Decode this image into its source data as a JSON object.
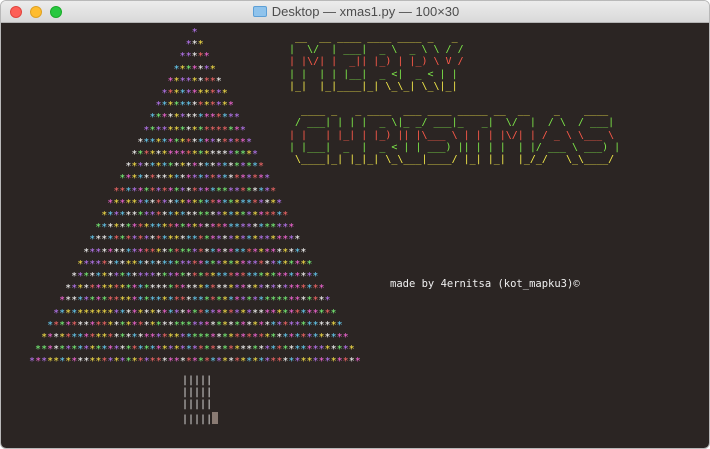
{
  "window": {
    "title": "Desktop — xmas1.py — 100×30",
    "icon": "folder-icon"
  },
  "terminal": {
    "background": "#2b2523",
    "credit": "made by 4ernitsa (kot_mapku3)©",
    "tree": {
      "glyph": "*",
      "colors": [
        "#ffffff",
        "#ffe84a",
        "#69d6ff",
        "#c07cff",
        "#ff6be0",
        "#7cff7c",
        "#ff6b6b"
      ],
      "trunk_line": "|||||",
      "trunk_rows": 4
    },
    "banner": {
      "merry": [
        "  __  __ ____ ____ ____ _   _  ",
        " |  \\/  | ___|  _ \\  _ \\ \\ / / ",
        " | |\\/| |  _|| |_) | |_) \\ V /  ",
        " | |  | | |__|  _ <|  _ < | |   ",
        " |_|  |_|____|_| \\_\\_| \\_\\|_|   "
      ],
      "christmas": [
        "   ____ _   _ ____  ___ ____ _____ __  __    _    ____  ",
        "  / ___| | | |  _ \\|_ _/ ___|_   _|  \\/  |  / \\  / ___| ",
        " | |   | |_| | |_) || |\\___ \\ | | | |\\/| | / _ \\ \\___ \\ ",
        " | |___|  _  |  _ < | | ___) || | | |  | |/ ___ \\ ___) |",
        "  \\____|_| |_|_| \\_\\___|____/ |_| |_|  |_/_/   \\_\\____/ "
      ],
      "line_colors": [
        "#f2e84a",
        "#7ee84a",
        "#ff5a4a",
        "#7ee84a",
        "#f2e84a"
      ]
    }
  }
}
